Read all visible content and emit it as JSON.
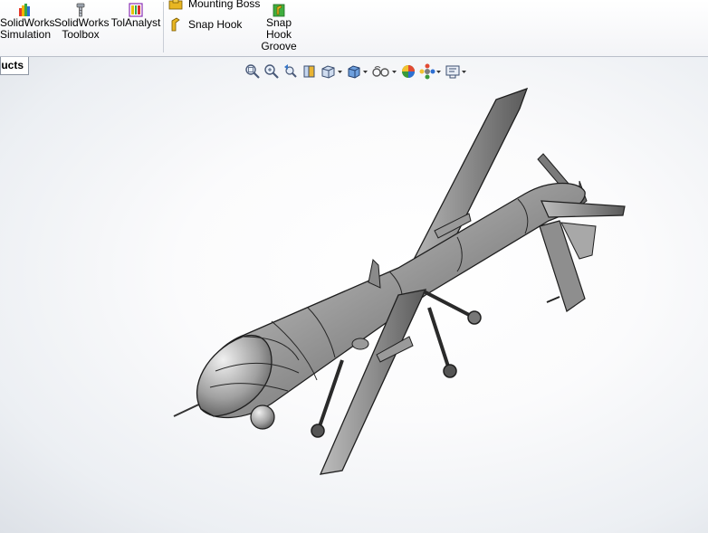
{
  "ribbon": {
    "tools": [
      {
        "label_line1": "SolidWorks",
        "label_line2": "Simulation",
        "icon": "simulation-icon"
      },
      {
        "label_line1": "SolidWorks",
        "label_line2": "Toolbox",
        "icon": "toolbox-icon"
      },
      {
        "label_line1": "TolAnalyst",
        "label_line2": "",
        "icon": "tolanalyst-icon"
      }
    ],
    "small_tools": [
      {
        "label": "Mounting Boss",
        "icon": "mounting-boss-icon"
      },
      {
        "label": "Snap Hook",
        "icon": "snap-hook-icon"
      }
    ],
    "snap_hook_groove": {
      "line1": "Snap",
      "line2": "Hook",
      "line3": "Groove",
      "icon": "snap-hook-groove-icon"
    }
  },
  "tabs": {
    "active_label": "ucts"
  },
  "heads_up_toolbar": [
    "zoom-to-fit-icon",
    "zoom-to-area-icon",
    "previous-view-icon",
    "section-view-icon",
    "view-orientation-icon",
    "display-style-icon",
    "hide-show-items-icon",
    "edit-appearance-icon",
    "apply-scene-icon",
    "view-settings-icon"
  ],
  "colors": {
    "ribbon_bg": "#f3f4f7",
    "model_fill": "#8c8c8c",
    "model_edge": "#1e1e1e"
  }
}
